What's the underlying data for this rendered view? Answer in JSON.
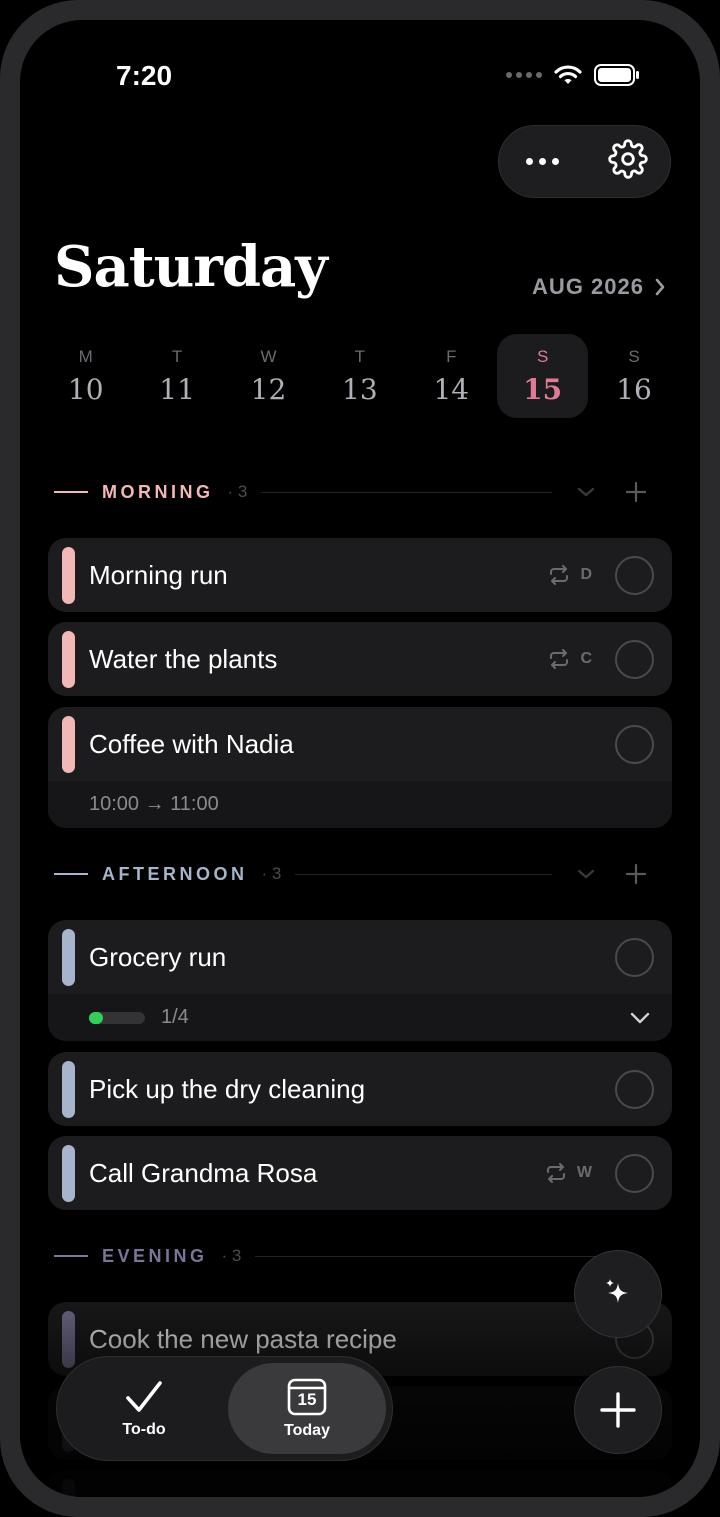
{
  "status_bar": {
    "time": "7:20"
  },
  "header": {
    "title": "Saturday",
    "month_label": "AUG 2026"
  },
  "week": [
    {
      "letter": "M",
      "num": "10"
    },
    {
      "letter": "T",
      "num": "11"
    },
    {
      "letter": "W",
      "num": "12"
    },
    {
      "letter": "T",
      "num": "13"
    },
    {
      "letter": "F",
      "num": "14"
    },
    {
      "letter": "S",
      "num": "15",
      "selected": true
    },
    {
      "letter": "S",
      "num": "16"
    }
  ],
  "sections": {
    "morning": {
      "label": "MORNING",
      "count": "· 3",
      "color": "#f2b8b5",
      "tasks": [
        {
          "title": "Morning run",
          "repeat": "D"
        },
        {
          "title": "Water the plants",
          "repeat": "C"
        },
        {
          "title": "Coffee with Nadia",
          "time": "10:00 → 11:00"
        }
      ]
    },
    "afternoon": {
      "label": "AFTERNOON",
      "count": "· 3",
      "color": "#a6b4cc",
      "tasks": [
        {
          "title": "Grocery run",
          "progress_label": "1/4",
          "progress": 0.25
        },
        {
          "title": "Pick up the dry cleaning"
        },
        {
          "title": "Call Grandma Rosa",
          "repeat": "W"
        }
      ]
    },
    "evening": {
      "label": "EVENING",
      "count": "· 3",
      "color": "#7a7498",
      "tasks": [
        {
          "title": "Cook the new pasta recipe"
        }
      ]
    }
  },
  "tabs": {
    "todo": "To-do",
    "today": "Today",
    "today_icon_num": "15"
  },
  "colors": {
    "accent": "#e07a96",
    "background": "#000000",
    "card": "#1c1c1e",
    "progress": "#30d158"
  }
}
